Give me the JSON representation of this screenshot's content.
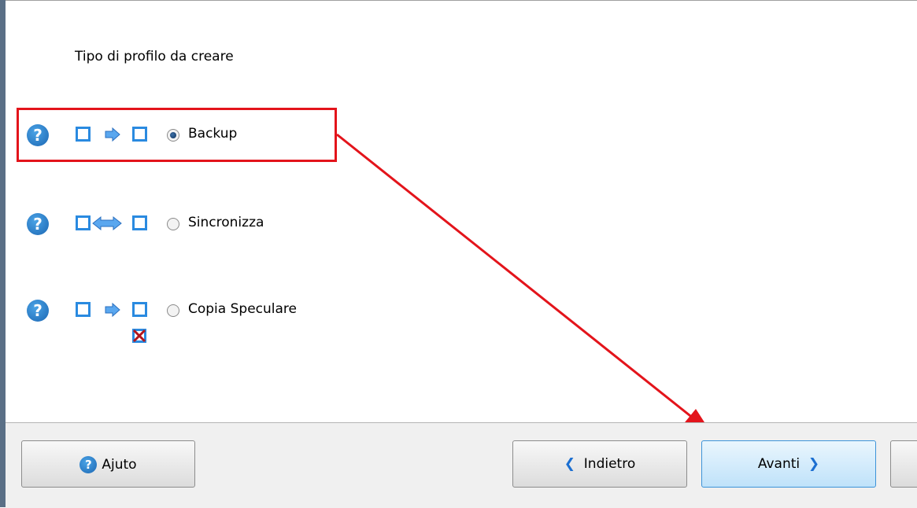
{
  "title": "Tipo di profilo da creare",
  "options": [
    {
      "label": "Backup",
      "selected": true,
      "icon": "backup-icon"
    },
    {
      "label": "Sincronizza",
      "selected": false,
      "icon": "sync-icon"
    },
    {
      "label": "Copia Speculare",
      "selected": false,
      "icon": "mirror-icon"
    }
  ],
  "help_glyph": "?",
  "buttons": {
    "help": "Ajuto",
    "back": "Indietro",
    "next": "Avanti"
  },
  "colors": {
    "annotation": "#e3141b",
    "accent": "#2a8ae0"
  }
}
